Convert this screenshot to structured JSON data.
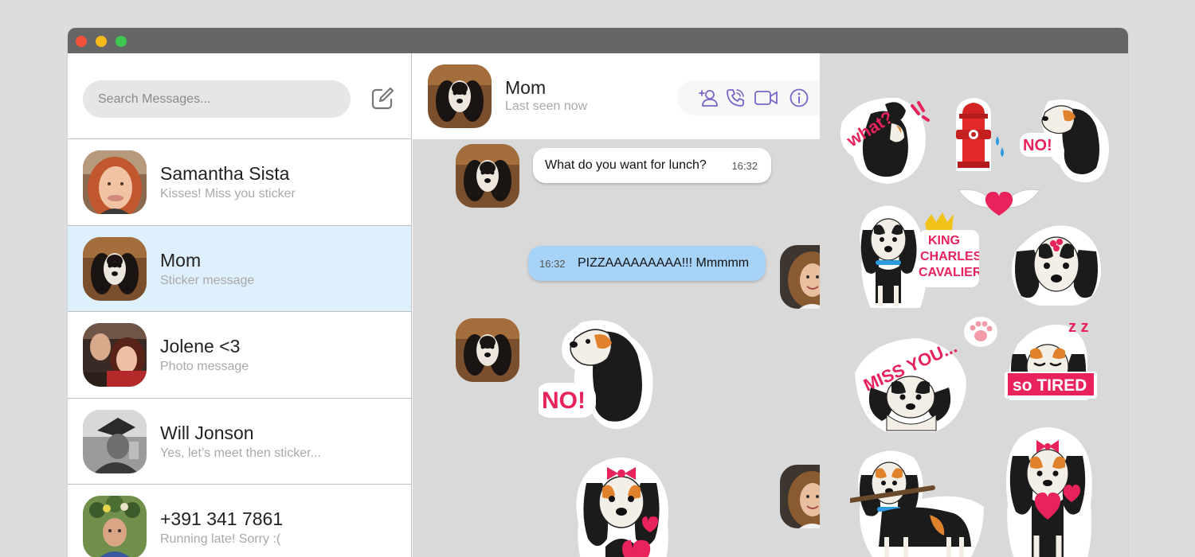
{
  "search": {
    "placeholder": "Search Messages..."
  },
  "icons": {
    "compose": "compose-icon",
    "add_contact": "add-contact-icon",
    "call": "phone-call-icon",
    "video": "video-camera-icon",
    "info": "info-icon"
  },
  "contacts": [
    {
      "name": "Samantha Sista",
      "preview": "Kisses! Miss you sticker"
    },
    {
      "name": "Mom",
      "preview": "Sticker message"
    },
    {
      "name": "Jolene <3",
      "preview": "Photo message"
    },
    {
      "name": "Will Jonson",
      "preview": "Yes, let’s meet then sticker..."
    },
    {
      "name": "+391 341 7861",
      "preview": "Running late! Sorry :("
    }
  ],
  "chat": {
    "name": "Mom",
    "status": "Last seen now",
    "messages": [
      {
        "direction": "in",
        "text": "What do you want for lunch?",
        "time": "16:32"
      },
      {
        "direction": "out",
        "text": "PIZZAAAAAAAAA!!! Mmmmm",
        "time": "16:32"
      },
      {
        "direction": "in",
        "sticker": "dog-no-sticker",
        "sticker_text": "NO!"
      },
      {
        "direction": "out",
        "sticker": "dog-bow-hearts-sticker"
      }
    ]
  },
  "sticker_panel": {
    "what": "what?",
    "no": "NO!",
    "king_1": "KING",
    "king_2": "CHARLES",
    "king_3": "CAVALIER",
    "miss": "MISS YOU...",
    "tired": "so TIRED",
    "zz": "z z"
  },
  "colors": {
    "accent": "#7b64c9",
    "sticker_pink": "#e8225b",
    "active_row": "#def0fc",
    "outgoing_bubble": "#a8d3f9",
    "titlebar": "#666666"
  }
}
